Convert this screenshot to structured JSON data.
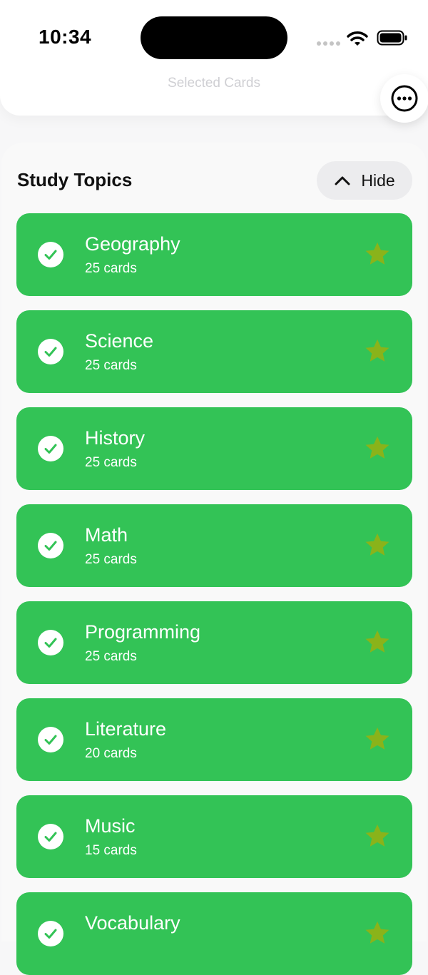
{
  "status": {
    "time": "10:34"
  },
  "header": {
    "selected_cards_label": "Selected Cards"
  },
  "section": {
    "title": "Study Topics",
    "hide_label": "Hide"
  },
  "topics": [
    {
      "name": "Geography",
      "count": "25 cards"
    },
    {
      "name": "Science",
      "count": "25 cards"
    },
    {
      "name": "History",
      "count": "25 cards"
    },
    {
      "name": "Math",
      "count": "25 cards"
    },
    {
      "name": "Programming",
      "count": "25 cards"
    },
    {
      "name": "Literature",
      "count": "20 cards"
    },
    {
      "name": "Music",
      "count": "15 cards"
    },
    {
      "name": "Vocabulary",
      "count": ""
    }
  ],
  "colors": {
    "topic_card": "#33c356",
    "star": "#8ab31a",
    "check": "#33c356",
    "hide_button_bg": "#ececee"
  },
  "icons": {
    "more": "ellipsis-circle-icon",
    "hide": "chevron-up-icon",
    "check": "checkmark-circle-icon",
    "favorite": "star-icon",
    "wifi": "wifi-icon",
    "battery": "battery-icon",
    "signal": "cellular-signal-icon"
  }
}
